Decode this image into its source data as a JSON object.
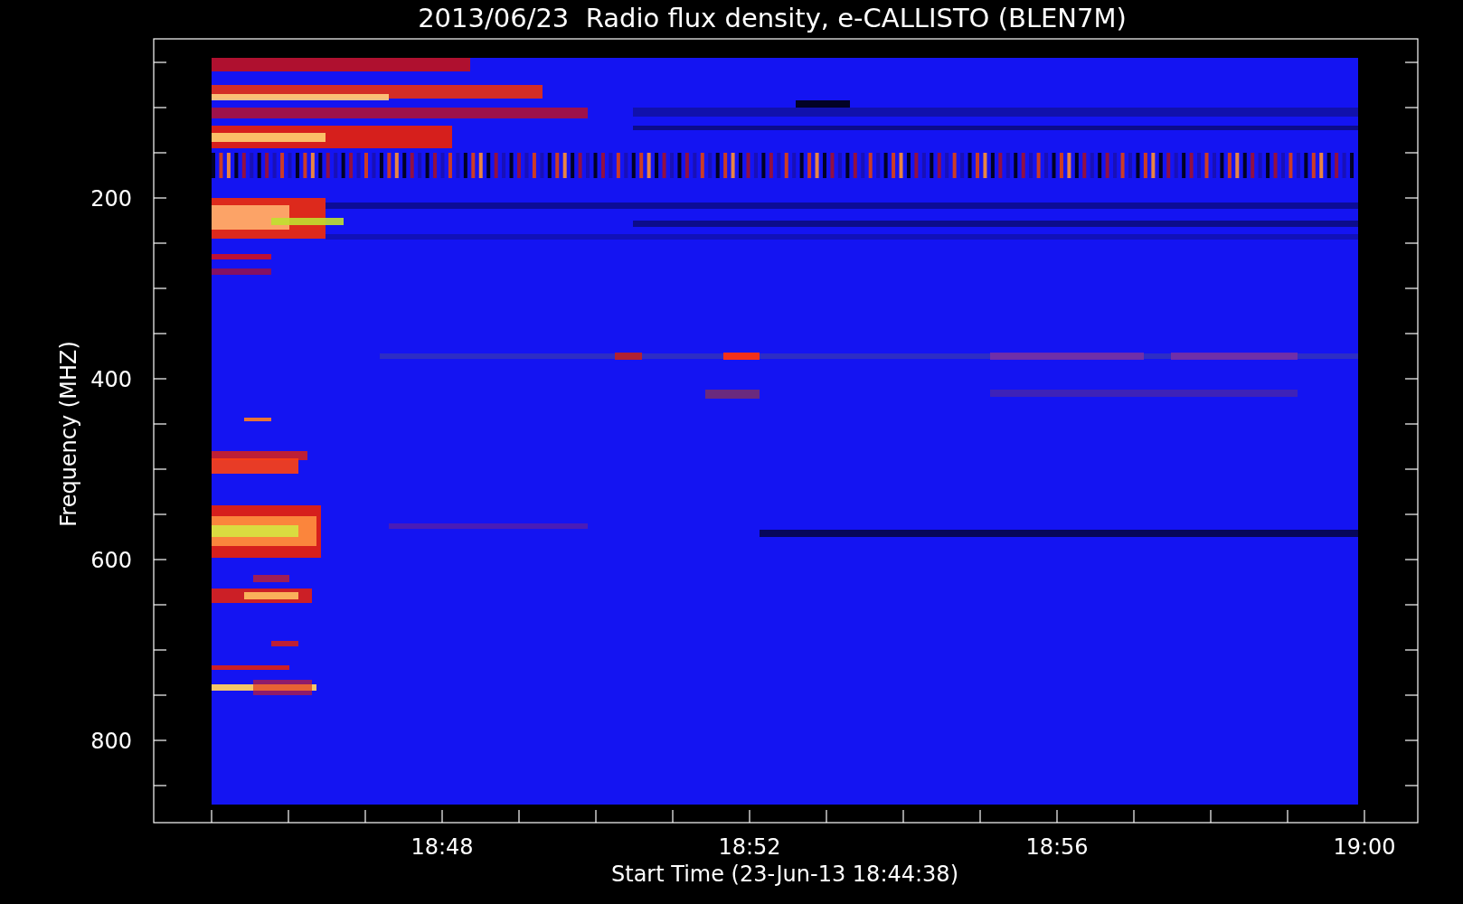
{
  "chart": {
    "title": "2013/06/23  Radio flux density, e-CALLISTO (BLEN7M)",
    "ylabel": "Frequency (MHZ)",
    "xlabel": "Start Time (23-Jun-13 18:44:38)",
    "yticks": [
      "200",
      "400",
      "600",
      "800"
    ],
    "xticks": [
      "18:48",
      "18:52",
      "18:56",
      "19:00"
    ]
  }
}
